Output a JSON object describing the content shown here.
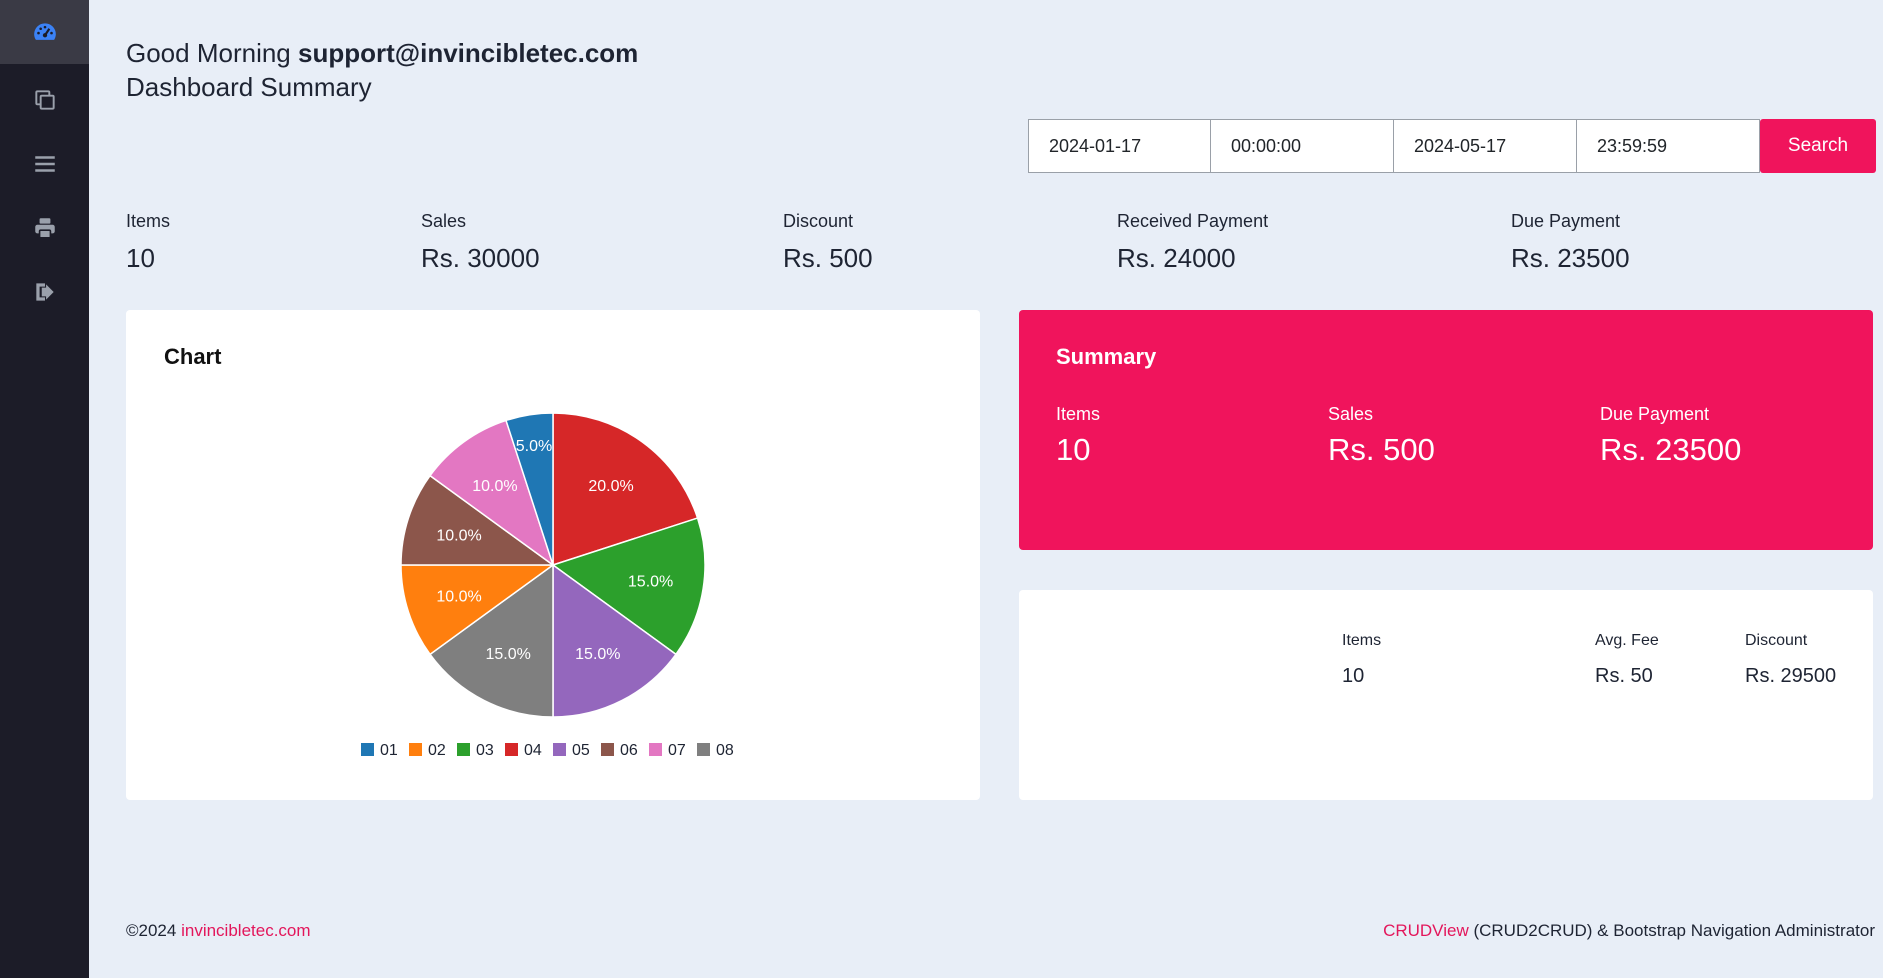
{
  "sidebar": {
    "items": [
      {
        "icon": "dashboard-icon",
        "active": true
      },
      {
        "icon": "copy-icon",
        "active": false
      },
      {
        "icon": "list-icon",
        "active": false
      },
      {
        "icon": "printer-icon",
        "active": false
      },
      {
        "icon": "logout-icon",
        "active": false
      }
    ],
    "accent_color": "#3b82f6"
  },
  "header": {
    "greeting_prefix": "Good Morning",
    "user_email": "support@invincibletec.com",
    "subtitle": "Dashboard Summary"
  },
  "filters": {
    "start_date": "2024-01-17",
    "start_time": "00:00:00",
    "end_date": "2024-05-17",
    "end_time": "23:59:59",
    "search_label": "Search"
  },
  "stats": [
    {
      "label": "Items",
      "value": "10"
    },
    {
      "label": "Sales",
      "value": "Rs. 30000"
    },
    {
      "label": "Discount",
      "value": "Rs. 500"
    },
    {
      "label": "Received Payment",
      "value": "Rs. 24000"
    },
    {
      "label": "Due Payment",
      "value": "Rs. 23500"
    }
  ],
  "chart_card": {
    "title": "Chart"
  },
  "chart_data": {
    "type": "pie",
    "title": "Chart",
    "categories": [
      "01",
      "02",
      "03",
      "04",
      "05",
      "06",
      "07",
      "08"
    ],
    "values": [
      5,
      10,
      15,
      20,
      15,
      10,
      10,
      15
    ],
    "slices": [
      {
        "category": "04",
        "value": 20.0,
        "label": "20.0%",
        "color": "#d62728"
      },
      {
        "category": "03",
        "value": 15.0,
        "label": "15.0%",
        "color": "#2ca02c"
      },
      {
        "category": "05",
        "value": 15.0,
        "label": "15.0%",
        "color": "#9467bd"
      },
      {
        "category": "08",
        "value": 15.0,
        "label": "15.0%",
        "color": "#7f7f7f"
      },
      {
        "category": "02",
        "value": 10.0,
        "label": "10.0%",
        "color": "#ff7f0e"
      },
      {
        "category": "06",
        "value": 10.0,
        "label": "10.0%",
        "color": "#8c564b"
      },
      {
        "category": "07",
        "value": 10.0,
        "label": "10.0%",
        "color": "#e377c2"
      },
      {
        "category": "01",
        "value": 5.0,
        "label": "5.0%",
        "color": "#1f77b4"
      }
    ],
    "legend": [
      {
        "label": "01",
        "color": "#1f77b4"
      },
      {
        "label": "02",
        "color": "#ff7f0e"
      },
      {
        "label": "03",
        "color": "#2ca02c"
      },
      {
        "label": "04",
        "color": "#d62728"
      },
      {
        "label": "05",
        "color": "#9467bd"
      },
      {
        "label": "06",
        "color": "#8c564b"
      },
      {
        "label": "07",
        "color": "#e377c2"
      },
      {
        "label": "08",
        "color": "#7f7f7f"
      }
    ],
    "legend_position": "bottom"
  },
  "summary": {
    "title": "Summary",
    "background_color": "#f0145c",
    "items": [
      {
        "label": "Items",
        "value": "10"
      },
      {
        "label": "Sales",
        "value": "Rs. 500"
      },
      {
        "label": "Due Payment",
        "value": "Rs. 23500"
      }
    ]
  },
  "details": {
    "items": [
      {
        "label": "Items",
        "value": "10"
      },
      {
        "label": "Avg. Fee",
        "value": "Rs. 50"
      },
      {
        "label": "Discount",
        "value": "Rs. 29500"
      }
    ]
  },
  "footer": {
    "copyright": "©2024",
    "site_link": "invincibletec.com",
    "product_link": "CRUDView",
    "product_rest": "(CRUD2CRUD) & Bootstrap Navigation Administrator",
    "link_color": "#e3165b"
  }
}
